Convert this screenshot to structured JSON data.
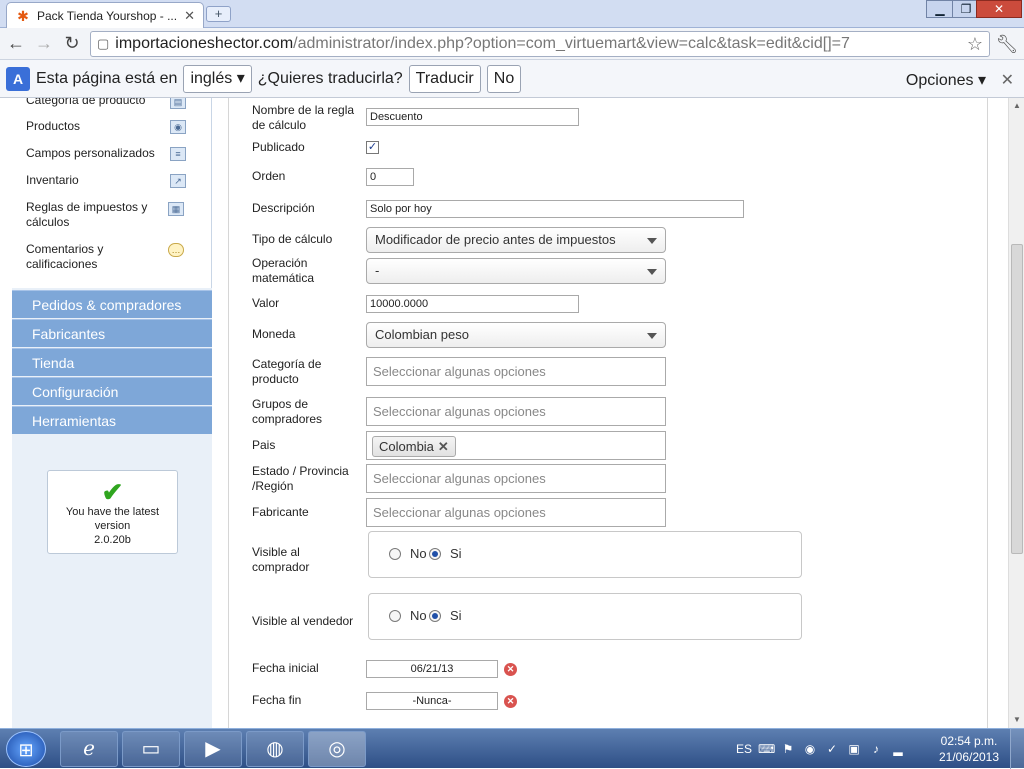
{
  "browser": {
    "tab_title": "Pack Tienda Yourshop - ...",
    "tab_close": "✕",
    "new_tab": "+",
    "window_controls": {
      "minimize": "▁",
      "maximize": "❐",
      "close": "✕"
    },
    "url_host": "importacioneshector.com",
    "url_path": "/administrator/index.php?option=com_virtuemart&view=calc&task=edit&cid[]=7"
  },
  "translate_bar": {
    "prefix": "Esta página está en",
    "language": "inglés ▾",
    "question": "¿Quieres traducirla?",
    "translate_button": "Traducir",
    "no_button": "No",
    "options": "Opciones ▾",
    "close": "✕"
  },
  "sidebar": {
    "items": [
      {
        "label": "Categoría de producto",
        "icon": "folder-icon"
      },
      {
        "label": "Productos",
        "icon": "camera-icon"
      },
      {
        "label": "Campos personalizados",
        "icon": "form-icon"
      },
      {
        "label": "Inventario",
        "icon": "chart-icon"
      },
      {
        "label": "Reglas de impuestos y cálculos",
        "icon": "calculator-icon"
      },
      {
        "label": "Comentarios y calificaciones",
        "icon": "comment-icon"
      }
    ],
    "groups": [
      "Pedidos & compradores",
      "Fabricantes",
      "Tienda",
      "Configuración",
      "Herramientas"
    ],
    "version_box": {
      "line1": "You have the latest version",
      "line2": "2.0.20b"
    }
  },
  "form": {
    "nombre_label": "Nombre de la regla de cálculo",
    "nombre_value": "Descuento",
    "publicado_label": "Publicado",
    "publicado_checked": "✓",
    "orden_label": "Orden",
    "orden_value": "0",
    "descripcion_label": "Descripción",
    "descripcion_value": "Solo por hoy",
    "tipo_label": "Tipo de cálculo",
    "tipo_value": "Modificador de precio antes de impuestos",
    "operacion_label": "Operación matemática",
    "operacion_value": "-",
    "valor_label": "Valor",
    "valor_value": "10000.0000",
    "moneda_label": "Moneda",
    "moneda_value": "Colombian peso",
    "categoria_label": "Categoría de producto",
    "placeholder": "Seleccionar algunas opciones",
    "grupos_label": "Grupos de compradores",
    "pais_label": "Pais",
    "pais_chip": "Colombia",
    "pais_chip_remove": "✕",
    "estado_label": "Estado / Provincia /Región",
    "fabricante_label": "Fabricante",
    "visible_comprador_label": "Visible al comprador",
    "visible_vendedor_label": "Visible al vendedor",
    "radio_no": "No",
    "radio_si": "Si",
    "fecha_inicial_label": "Fecha inicial",
    "fecha_inicial_value": "06/21/13",
    "fecha_fin_label": "Fecha fin",
    "fecha_fin_value": "-Nunca-",
    "clear": "✕"
  },
  "taskbar": {
    "language": "ES",
    "time": "02:54 p.m.",
    "date": "21/06/2013"
  }
}
